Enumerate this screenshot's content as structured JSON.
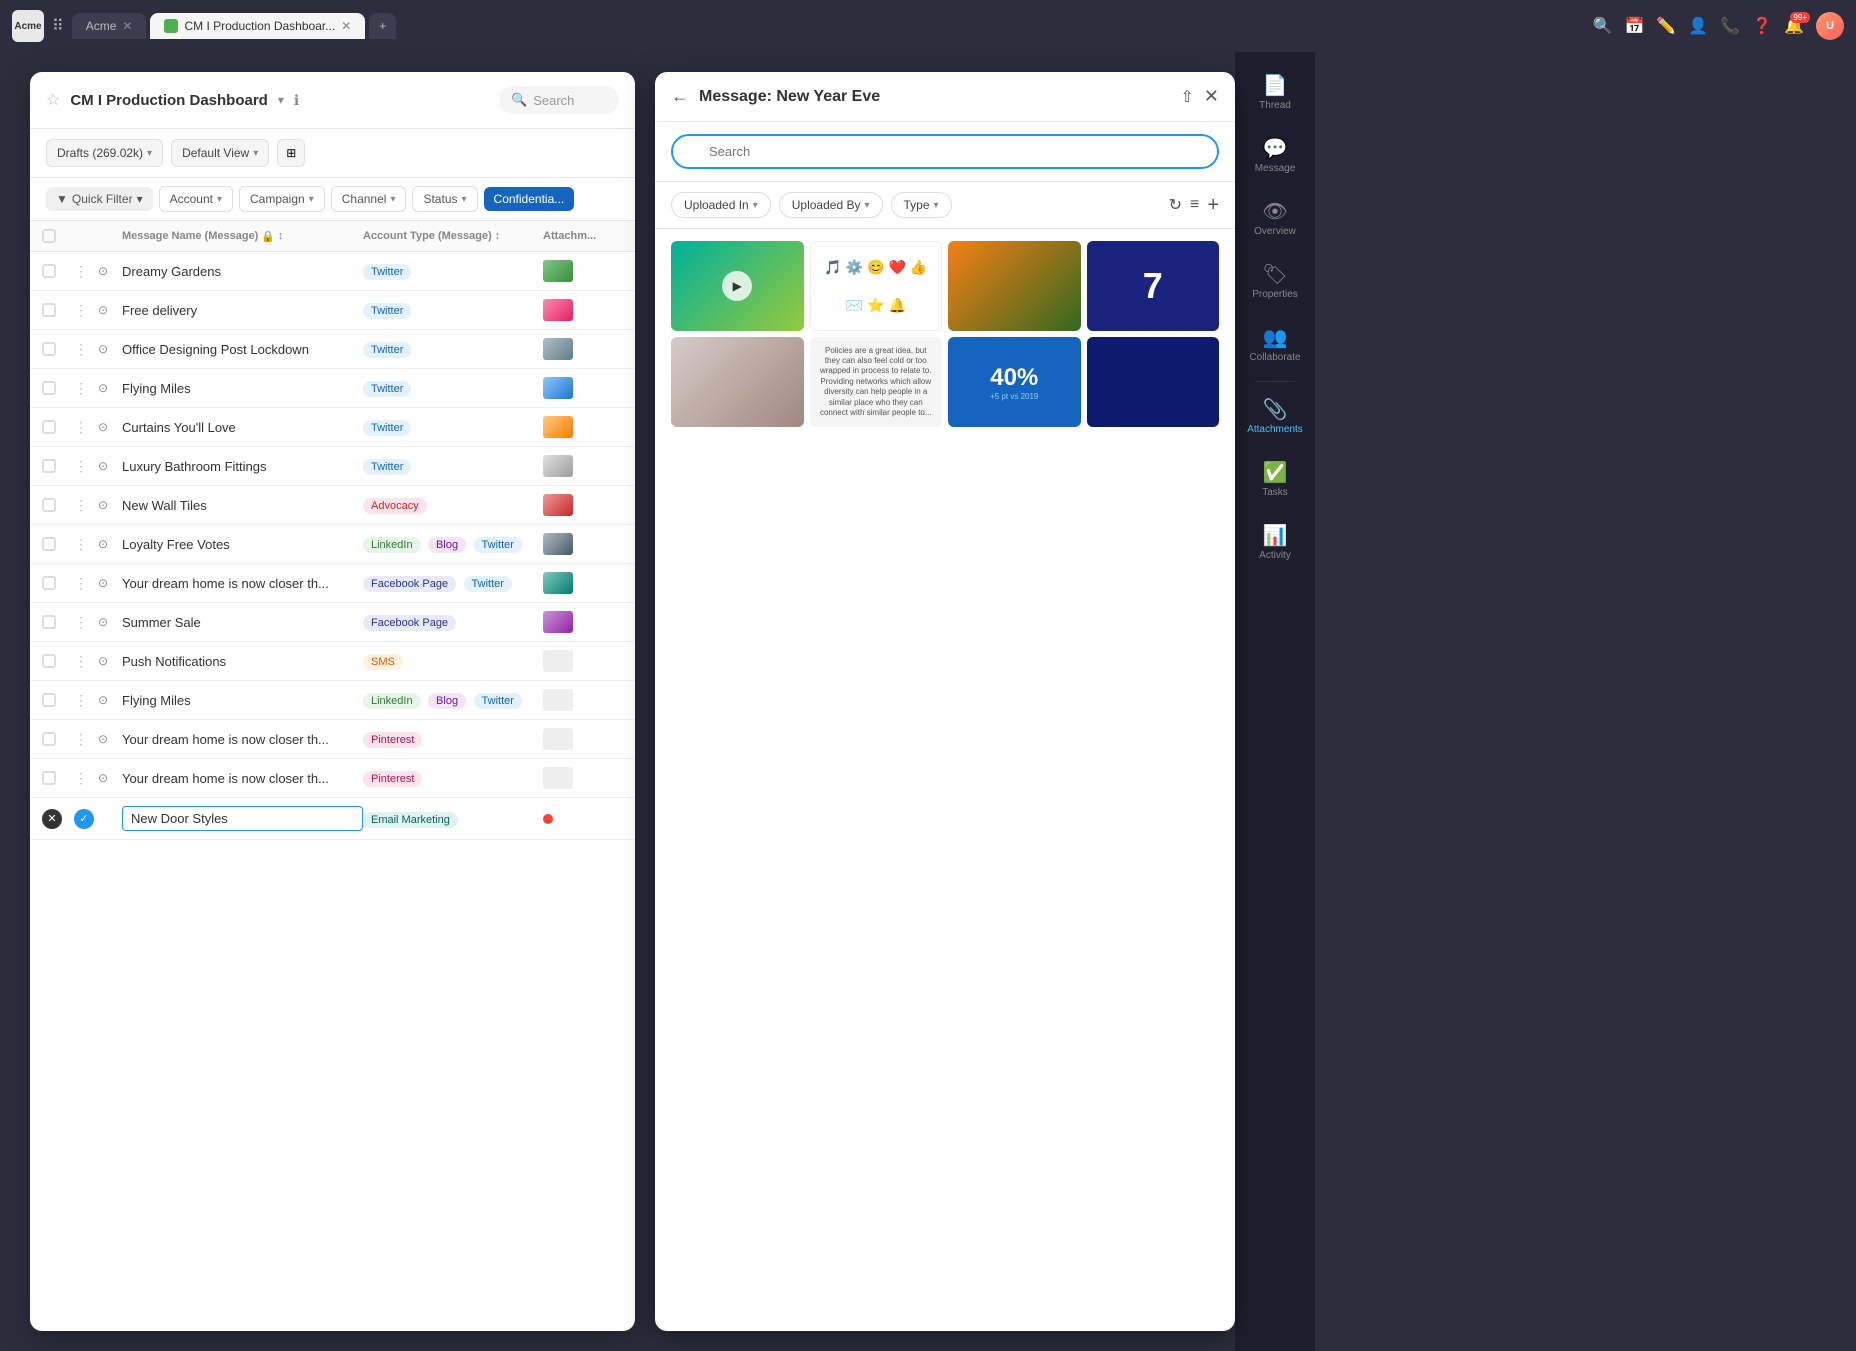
{
  "browser": {
    "logo": "Acme",
    "tabs": [
      {
        "label": "Acme",
        "active": false
      },
      {
        "label": "CM I Production Dashboar...",
        "active": true,
        "has_icon": true
      }
    ],
    "add_tab": "+",
    "nav_icons": [
      "search",
      "calendar",
      "pencil",
      "user",
      "phone",
      "help",
      "notification",
      "avatar"
    ],
    "notification_count": "99+"
  },
  "dashboard": {
    "title": "CM I Production Dashboard",
    "search_placeholder": "Search",
    "drafts_label": "Drafts (269.02k)",
    "default_view_label": "Default View",
    "filters": {
      "quick_filter": "Quick Filter",
      "account": "Account",
      "campaign": "Campaign",
      "channel": "Channel",
      "status": "Status",
      "confidential": "Confidentia..."
    },
    "table_headers": {
      "message_name": "Message Name (Message)",
      "account_type": "Account Type (Message)",
      "attachments": "Attachm..."
    },
    "rows": [
      {
        "name": "Dreamy Gardens",
        "tags": [
          "Twitter"
        ],
        "tag_types": [
          "twitter"
        ]
      },
      {
        "name": "Free delivery",
        "tags": [
          "Twitter"
        ],
        "tag_types": [
          "twitter"
        ]
      },
      {
        "name": "Office Designing Post Lockdown",
        "tags": [
          "Twitter"
        ],
        "tag_types": [
          "twitter"
        ]
      },
      {
        "name": "Flying Miles",
        "tags": [
          "Twitter"
        ],
        "tag_types": [
          "twitter"
        ]
      },
      {
        "name": "Curtains You'll Love",
        "tags": [
          "Twitter"
        ],
        "tag_types": [
          "twitter"
        ]
      },
      {
        "name": "Luxury Bathroom Fittings",
        "tags": [
          "Twitter"
        ],
        "tag_types": [
          "twitter"
        ]
      },
      {
        "name": "New Wall Tiles",
        "tags": [
          "Advocacy"
        ],
        "tag_types": [
          "advocacy"
        ]
      },
      {
        "name": "Loyalty Free Votes",
        "tags": [
          "LinkedIn",
          "Blog",
          "Twitter"
        ],
        "tag_types": [
          "linkedin",
          "blog",
          "twitter"
        ]
      },
      {
        "name": "Your dream home is now closer th...",
        "tags": [
          "Facebook Page",
          "Twitter"
        ],
        "tag_types": [
          "facebook",
          "twitter"
        ]
      },
      {
        "name": "Summer Sale",
        "tags": [
          "Facebook Page"
        ],
        "tag_types": [
          "facebook"
        ]
      },
      {
        "name": "Push Notifications",
        "tags": [
          "SMS"
        ],
        "tag_types": [
          "sms"
        ]
      },
      {
        "name": "Flying Miles",
        "tags": [
          "LinkedIn",
          "Blog",
          "Twitter"
        ],
        "tag_types": [
          "linkedin",
          "blog",
          "twitter"
        ]
      },
      {
        "name": "Your dream home is now closer th...",
        "tags": [
          "Pinterest"
        ],
        "tag_types": [
          "pinterest"
        ]
      },
      {
        "name": "Your dream home is now closer th...",
        "tags": [
          "Pinterest"
        ],
        "tag_types": [
          "pinterest"
        ]
      }
    ],
    "new_row": {
      "name": "New Door Styles",
      "tag": "Email Marketing",
      "tag_type": "email"
    }
  },
  "dialog": {
    "title": "Message: New Year Eve",
    "search_placeholder": "Search",
    "filters": {
      "uploaded_in": "Uploaded In",
      "uploaded_by": "Uploaded By",
      "type": "Type"
    },
    "images": [
      {
        "type": "green-video",
        "has_play": true
      },
      {
        "type": "icons"
      },
      {
        "type": "produce"
      },
      {
        "type": "number",
        "value": "7"
      },
      {
        "type": "interior"
      },
      {
        "type": "flags"
      },
      {
        "type": "percent",
        "value": "40%",
        "sub": "+5 pt vs 2019"
      },
      {
        "type": "awards"
      }
    ]
  },
  "sidebar": {
    "items": [
      {
        "icon": "📄",
        "label": "Thread"
      },
      {
        "icon": "💬",
        "label": "Message"
      },
      {
        "icon": "👁",
        "label": "Overview"
      },
      {
        "icon": "🏷",
        "label": "Properties"
      },
      {
        "icon": "👥",
        "label": "Collaborate"
      },
      {
        "icon": "📎",
        "label": "Attachments",
        "active": true
      },
      {
        "icon": "✅",
        "label": "Tasks"
      },
      {
        "icon": "📊",
        "label": "Activity"
      }
    ]
  }
}
